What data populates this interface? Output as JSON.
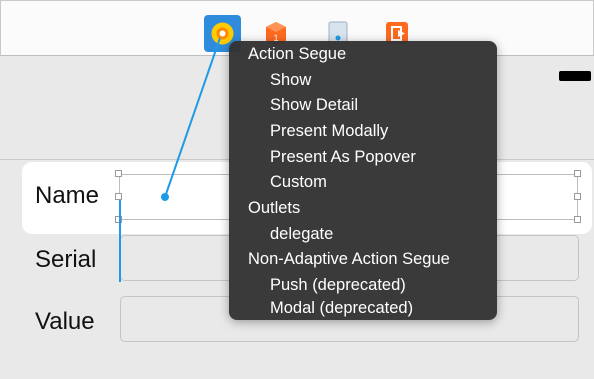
{
  "dock": {
    "icons": [
      "view-controller-icon",
      "first-responder-icon",
      "storyboard-reference-icon",
      "exit-icon"
    ]
  },
  "form": {
    "rows": [
      {
        "label": "Name"
      },
      {
        "label": "Serial"
      },
      {
        "label": "Value"
      }
    ]
  },
  "menu": {
    "sections": [
      {
        "title": "Action Segue",
        "items": [
          "Show",
          "Show Detail",
          "Present Modally",
          "Present As Popover",
          "Custom"
        ]
      },
      {
        "title": "Outlets",
        "items": [
          "delegate"
        ]
      },
      {
        "title": "Non-Adaptive Action Segue",
        "items": [
          "Push (deprecated)",
          "Modal (deprecated)"
        ]
      }
    ]
  },
  "colors": {
    "connection": "#1e9be6",
    "highlight": "#2f8cdc",
    "accent_orange": "#ff6a1f"
  }
}
